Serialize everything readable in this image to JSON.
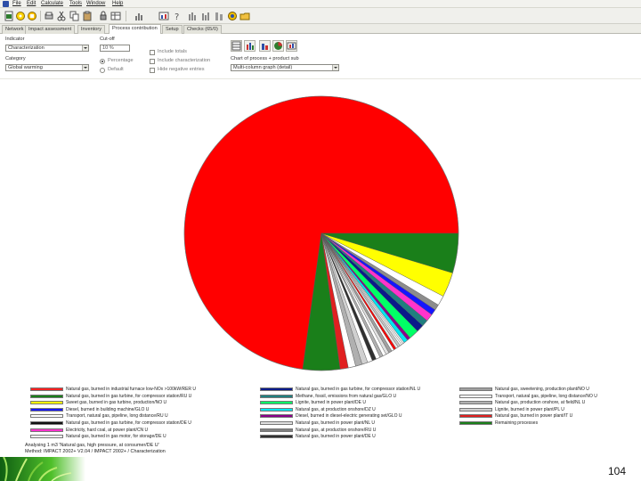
{
  "menu": {
    "items": [
      "File",
      "Edit",
      "Calculate",
      "Tools",
      "Window",
      "Help"
    ]
  },
  "toolbar": {
    "buttons": [
      "new-icon",
      "open-icon",
      "save-icon",
      "print-icon",
      "cut-icon",
      "copy-icon",
      "paste-icon",
      "lock-icon",
      "table-icon",
      "chart-icon",
      "bar-chart-icon",
      "graph-icon",
      "compare-icon",
      "network-icon",
      "folder-icon"
    ]
  },
  "tabs": [
    "Network",
    "Impact assessment",
    "Inventory",
    "Process contribution",
    "Setup",
    "Checks (65/0)"
  ],
  "active_tab": "Process contribution",
  "controls": {
    "indicator_label": "Indicator",
    "indicator_value": "Characterization",
    "category_label": "Category",
    "category_value": "Global warming",
    "cutoff_label": "Cut-off",
    "cutoff_value": "10 %",
    "radio_percent": "Percentage",
    "radio_default": "Default",
    "check_1": "Include totals",
    "check_2": "Include characterization",
    "check_3": "Hide negative entries",
    "chart_type_label": "Chart of process + product sub",
    "chart_type_value": "Multi-column graph (detail)",
    "chart_buttons": [
      "table-view-icon",
      "bar-view-icon",
      "column-view-icon",
      "pie-view-icon",
      "export-view-icon"
    ]
  },
  "colors": {
    "accent": "#2e4fa8",
    "window_bg": "#ffffff",
    "toolbar_bg": "#f0f0ec"
  },
  "chart_data": {
    "type": "pie",
    "title": "",
    "values": [
      75.0,
      4.5,
      1.0,
      0.9,
      0.8,
      0.7,
      0.6,
      0.5,
      0.5,
      0.4,
      0.4,
      0.4,
      0.4,
      0.3,
      0.3,
      0.3,
      0.3,
      0.2,
      0.2,
      0.2,
      0.5,
      0.4,
      1.2,
      0.9,
      0.8,
      0.9,
      0.7,
      0.7,
      1.2,
      3.0,
      4.8
    ],
    "colors": [
      "#ff0000",
      "#1a7f1a",
      "#e02020",
      "#ffffff",
      "#b0b0b0",
      "#d0d0d0",
      "#ffffff",
      "#303030",
      "#ffffff",
      "#b0b0b0",
      "#ffffff",
      "#e0e0e0",
      "#a0a0a0",
      "#ffffff",
      "#ff0000",
      "#e8e8e8",
      "#c8c8c8",
      "#ffffff",
      "#ffffff",
      "#f0f0f0",
      "#00e5ee",
      "#8b008b",
      "#00ff66",
      "#0a1a8a",
      "#1f7f7f",
      "#ff33cc",
      "#1515ff",
      "#8c8c8c",
      "#ffffff",
      "#ffff00",
      "#1a7f1a"
    ],
    "legend": [
      {
        "label": "Natural gas, burned in industrial furnace low-NOx >100kW/RER U",
        "color": "#ff2020"
      },
      {
        "label": "Natural gas, burned in gas turbine, for compressor station/RU U",
        "color": "#1a7f1a"
      },
      {
        "label": "Sweet gas, burned in gas turbine, production/NO U",
        "color": "#ffff00"
      },
      {
        "label": "Diesel, burned in building machine/GLO U",
        "color": "#1515ff"
      },
      {
        "label": "Transport, natural gas, pipeline, long distance/RU U",
        "color": "#ffffff"
      },
      {
        "label": "Natural gas, burned in gas turbine, for compressor station/DE U",
        "color": "#101010"
      },
      {
        "label": "Electricity, hard coal, at power plant/CN U",
        "color": "#ff33cc"
      },
      {
        "label": "Natural gas, burned in gas motor, for storage/DE U",
        "color": "#ffffff"
      },
      {
        "label": "Natural gas, burned in gas turbine, for compressor station/NL U",
        "color": "#0a1a8a"
      },
      {
        "label": "Methane, fossil, emissions from natural gas/GLO U",
        "color": "#1f7f7f"
      },
      {
        "label": "Lignite, burned in power plant/DE U",
        "color": "#00ff66"
      },
      {
        "label": "Natural gas, at production onshore/DZ U",
        "color": "#00e5ee"
      },
      {
        "label": "Diesel, burned in diesel-electric generating set/GLO U",
        "color": "#8b008b"
      },
      {
        "label": "Natural gas, burned in power plant/NL U",
        "color": "#e0e0e0"
      },
      {
        "label": "Natural gas, at production onshore/RU U",
        "color": "#808080"
      },
      {
        "label": "Natural gas, burned in power plant/DE U",
        "color": "#303030"
      },
      {
        "label": "Natural gas, sweetening, production plant/NO U",
        "color": "#a0a0a0"
      },
      {
        "label": "Transport, natural gas, pipeline, long distance/NO U",
        "color": "#ffffff"
      },
      {
        "label": "Natural gas, production onshore, at field/NL U",
        "color": "#b0b0b0"
      },
      {
        "label": "Lignite, burned in power plant/PL U",
        "color": "#d0d0d0"
      },
      {
        "label": "Natural gas, burned in power plant/IT U",
        "color": "#e02020"
      },
      {
        "label": "Remaining processes",
        "color": "#1a7f1a"
      }
    ]
  },
  "footnote": {
    "line1": "Analysing 1 m3 'Natural gas, high pressure, at consumer/DE U'",
    "line2": "Method: IMPACT 2002+ V2.04 / IMPACT 2002+ / Characterization"
  },
  "page_number": "104"
}
